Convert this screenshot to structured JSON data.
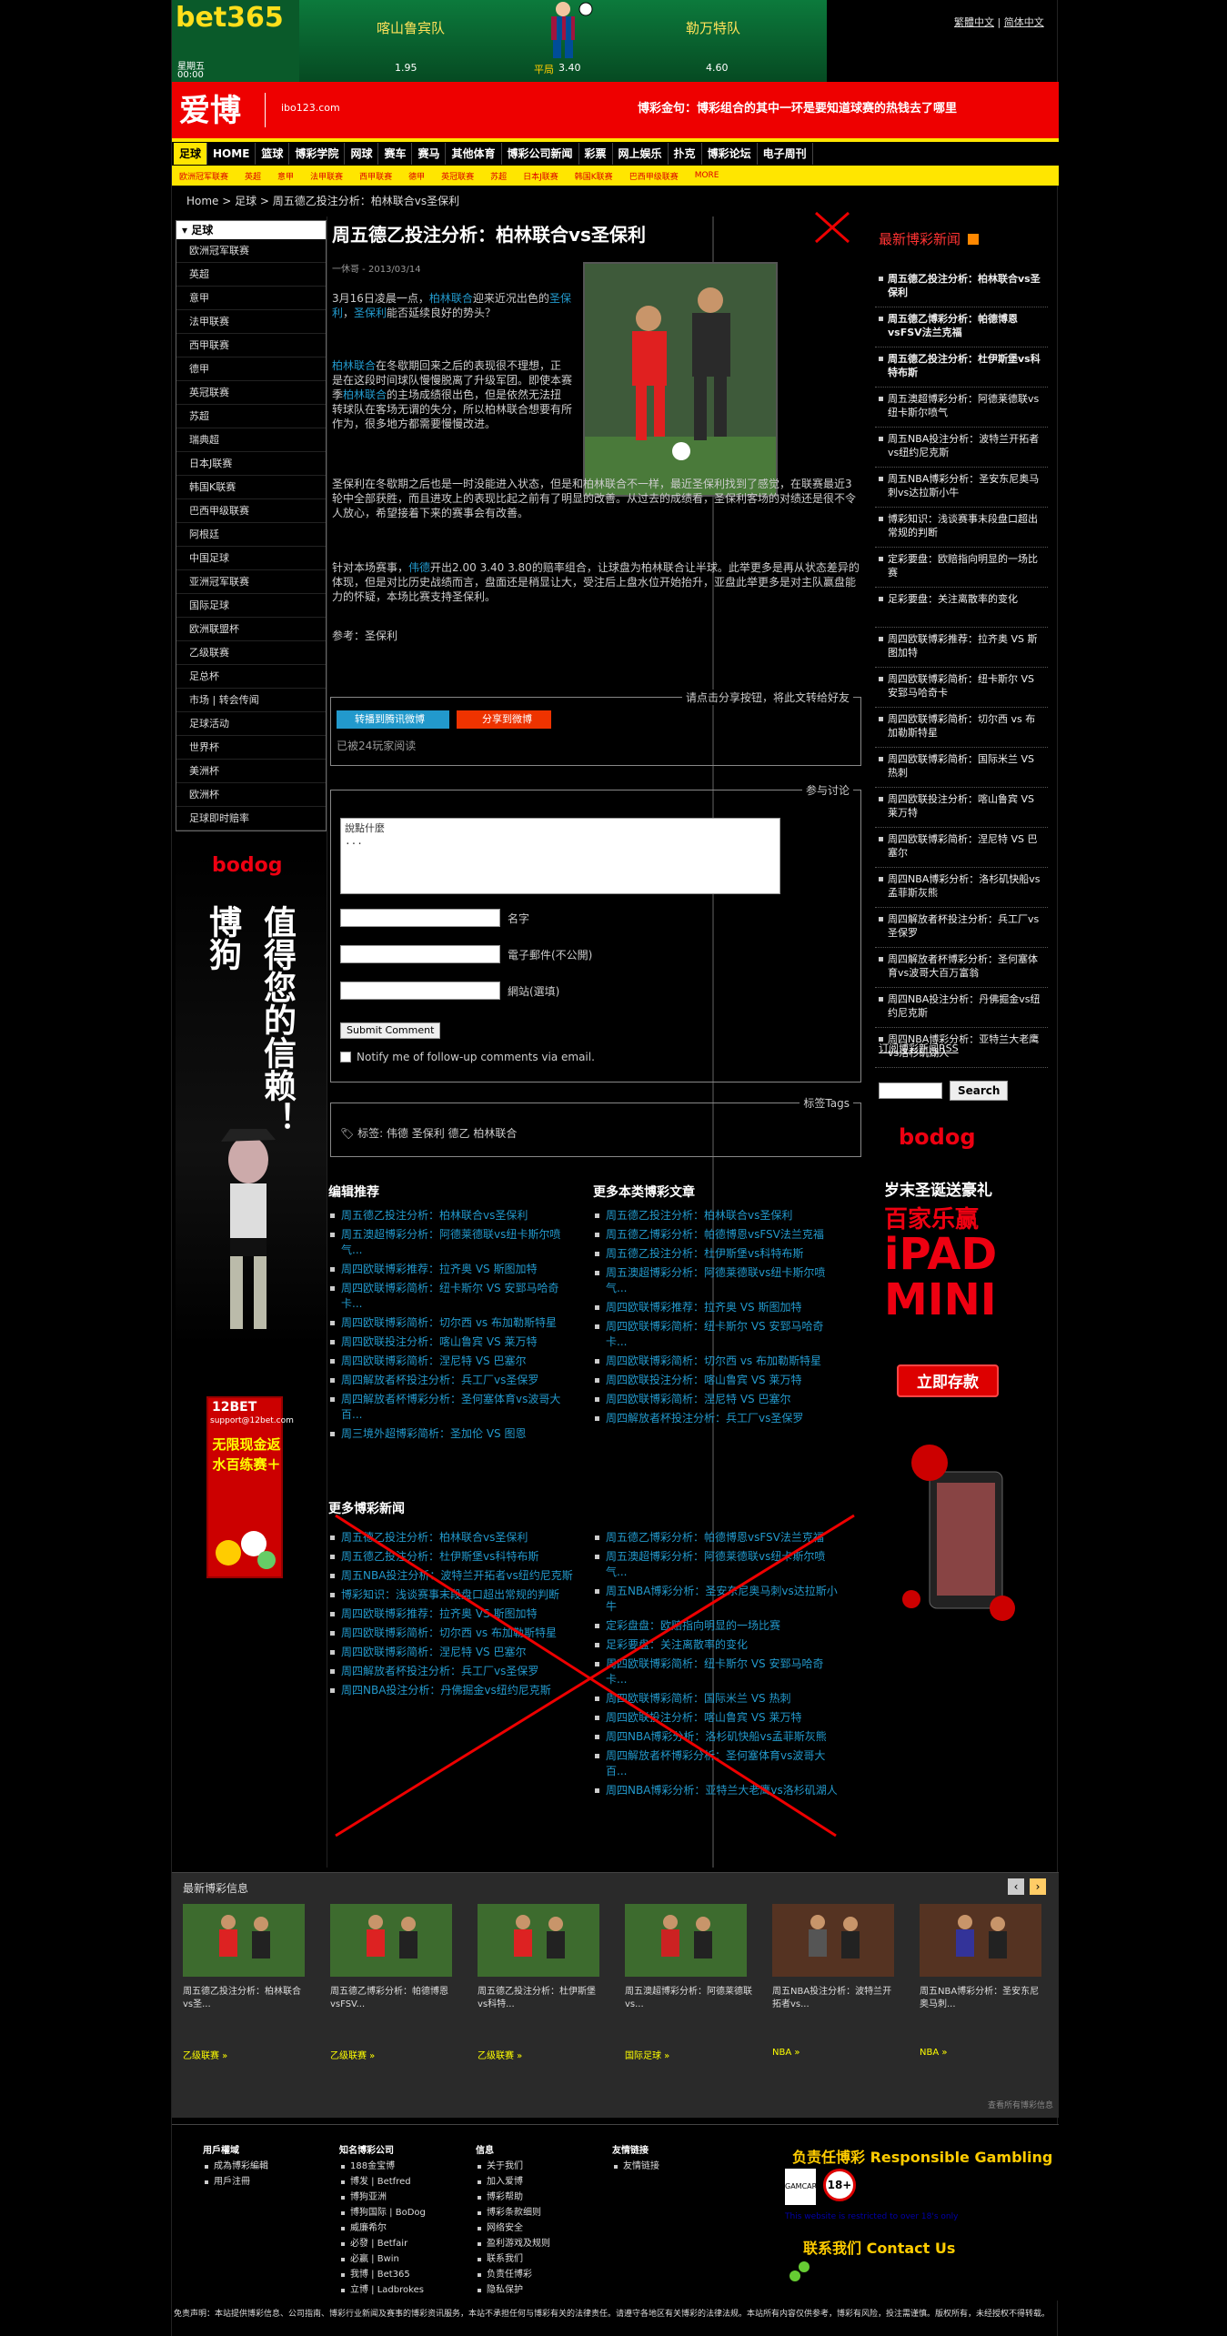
{
  "top": {
    "brand_a": "bet",
    "brand_b": "365",
    "day": "星期五",
    "time": "00:00",
    "home_team": "喀山鲁宾队",
    "away_team": "勒万特队",
    "odd_home": "1.95",
    "odd_draw": "3.40",
    "odd_away": "4.60",
    "draw_label": "平局",
    "links": [
      "繁體中文",
      "简体中文"
    ]
  },
  "aibo": {
    "logo": "爱博",
    "url": "ibo123.com",
    "slogan": "博彩金句：博彩组合的其中一环是要知道球赛的热钱去了哪里"
  },
  "nav": [
    "足球",
    "HOME",
    "篮球",
    "博彩学院",
    "网球",
    "赛车",
    "赛马",
    "其他体育",
    "博彩公司新闻",
    "彩票",
    "网上娱乐",
    "扑克",
    "博彩论坛",
    "电子周刊"
  ],
  "subnav": [
    "欧洲冠军联赛",
    "英超",
    "意甲",
    "法甲联赛",
    "西甲联赛",
    "德甲",
    "英冠联赛",
    "苏超",
    "日本J联赛",
    "韩国K联赛",
    "巴西甲级联赛",
    "MORE"
  ],
  "breadcrumb": "Home > 足球 > 周五德乙投注分析：柏林联合vs圣保利",
  "leftcat": {
    "head": "足球",
    "items": [
      "欧洲冠军联赛",
      "英超",
      "意甲",
      "法甲联赛",
      "西甲联赛",
      "德甲",
      "英冠联赛",
      "苏超",
      "瑞典超",
      "日本J联赛",
      "韩国K联赛",
      "巴西甲级联赛",
      "阿根廷",
      "中国足球",
      "亚洲冠军联赛",
      "国际足球",
      "欧洲联盟杯",
      "乙级联赛",
      "足总杯",
      "市场 | 转会传闻",
      "足球活动",
      "世界杯",
      "美洲杯",
      "欧洲杯",
      "足球即时赔率"
    ]
  },
  "bodog_left": {
    "brand": "bodog",
    "cn": "博狗",
    "slogan1": "博狗",
    "slogan2": "值得您的信赖！"
  },
  "ad12": {
    "brand": "12BET",
    "site": "support@12bet.com",
    "copy": "无限现金返水百练赛＋"
  },
  "article": {
    "title": "周五德乙投注分析：柏林联合vs圣保利",
    "meta": "一休哥 - 2013/03/14",
    "p1_pre": "3月16日凌晨一点，",
    "p1_link1": "柏林联合",
    "p1_mid": "迎来近况出色的",
    "p1_link2": "圣保利",
    "p1_mid2": "，",
    "p1_link3": "圣保利",
    "p1_post": "能否延续良好的势头？",
    "p2_link1": "柏林联合",
    "p2_a": "在冬歇期回来之后的表现很不理想，正是在这段时间球队慢慢脱离了升级军团。即使本赛季",
    "p2_link2": "柏林联合",
    "p2_b": "的主场成绩很出色，但是依然无法扭转球队在客场无谓的失分，所以柏林联合想要有所作为，很多地方都需要慢慢改进。",
    "p3": "圣保利在冬歇期之后也是一时没能进入状态，但是和柏林联合不一样，最近圣保利找到了感觉，在联赛最近3轮中全部获胜，而且进攻上的表现比起之前有了明显的改善。从过去的成绩看，圣保利客场的对绩还是很不令人放心，希望接着下来的赛事会有改善。",
    "p4_pre": "针对本场赛事，",
    "p4_link": "伟德",
    "p4_post": "开出2.00 3.40 3.80的赔率组合，让球盘为柏林联合让半球。此举更多是再从状态差异的体现，但是对比历史战绩而言，盘面还是稍显让大，受注后上盘水位开始抬升，亚盘此举更多是对主队赢盘能力的怀疑，本场比赛支持圣保利。",
    "ref": "参考：圣保利"
  },
  "share": {
    "legend": "请点击分享按钮，将此文转给好友",
    "btn1": "转播到腾讯微博",
    "btn2": "分享到微博",
    "read": "已被24玩家阅读"
  },
  "comment": {
    "legend": "参与讨论",
    "text": "說點什麼\n...",
    "name": "名字",
    "email": "電子郵件(不公開)",
    "site": "網站(選填)",
    "submit": "Submit Comment",
    "notify": "Notify me of follow-up comments via email."
  },
  "tags": {
    "legend": "标签Tags",
    "line": "标签: 伟德 圣保利 德乙 柏林联合"
  },
  "editor": {
    "head": "编辑推荐",
    "items": [
      "周五德乙投注分析：柏林联合vs圣保利",
      "周五澳超博彩分析：阿德莱德联vs纽卡斯尔喷气...",
      "周四欧联博彩推荐：拉齐奥 VS 斯图加特",
      "周四欧联博彩简析：纽卡斯尔 VS 安郅马哈奇卡...",
      "周四欧联博彩简析：切尔西 vs 布加勒斯特星",
      "周四欧联投注分析：喀山鲁宾 VS 莱万特",
      "周四欧联博彩简析：涅尼特 VS 巴塞尔",
      "周四解放者杯投注分析：兵工厂vs圣保罗",
      "周四解放者杯博彩分析：圣何塞体育vs波哥大百...",
      "周三境外超博彩简析：圣加伦 VS 图恩"
    ]
  },
  "more_cat": {
    "head": "更多本类博彩文章",
    "items": [
      "周五德乙投注分析：柏林联合vs圣保利",
      "周五德乙博彩分析：帕德博恩vsFSV法兰克福",
      "周五德乙投注分析：杜伊斯堡vs科特布斯",
      "周五澳超博彩分析：阿德莱德联vs纽卡斯尔喷气...",
      "周四欧联博彩推荐：拉齐奥 VS 斯图加特",
      "周四欧联博彩简析：纽卡斯尔 VS 安郅马哈奇卡...",
      "周四欧联博彩简析：切尔西 vs 布加勒斯特星",
      "周四欧联投注分析：喀山鲁宾 VS 莱万特",
      "周四欧联博彩简析：涅尼特 VS 巴塞尔",
      "周四解放者杯投注分析：兵工厂vs圣保罗"
    ]
  },
  "more_news": {
    "head": "更多博彩新闻",
    "left": [
      "周五德乙投注分析：柏林联合vs圣保利",
      "周五德乙投注分析：杜伊斯堡vs科特布斯",
      "周五NBA投注分析：波特兰开拓者vs纽约尼克斯",
      "博彩知识：浅谈赛事末段盘口超出常规的判断",
      "周四欧联博彩推荐：拉齐奥 VS 斯图加特",
      "周四欧联博彩简析：切尔西 vs 布加勒斯特星",
      "周四欧联博彩简析：涅尼特 VS 巴塞尔",
      "周四解放者杯投注分析：兵工厂vs圣保罗",
      "周四NBA投注分析：丹佛掘金vs纽约尼克斯"
    ],
    "right": [
      "周五德乙博彩分析：帕德博恩vsFSV法兰克福",
      "周五澳超博彩分析：阿德莱德联vs纽卡斯尔喷气...",
      "周五NBA博彩分析：圣安东尼奥马刺vs达拉斯小牛",
      "定彩盘盘：欧赔指向明显的一场比赛",
      "足彩要盘：关注离散率的变化",
      "周四欧联博彩简析：纽卡斯尔 VS 安郅马哈奇卡...",
      "周四欧联博彩简析：国际米兰 VS 热刺",
      "周四欧联投注分析：喀山鲁宾 VS 莱万特",
      "周四NBA博彩分析：洛杉矶快船vs孟菲斯灰熊",
      "周四解放者杯博彩分析：圣何塞体育vs波哥大百...",
      "周四NBA博彩分析：亚特兰大老鹰vs洛杉矶湖人"
    ]
  },
  "right": {
    "head": "最新博彩新闻",
    "items": [
      "周五德乙投注分析：柏林联合vs圣保利",
      "周五德乙博彩分析：帕德博恩vsFSV法兰克福",
      "周五德乙投注分析：杜伊斯堡vs科特布斯",
      "周五澳超博彩分析：阿德莱德联vs纽卡斯尔喷气",
      "周五NBA投注分析：波特兰开拓者vs纽约尼克斯",
      "周五NBA博彩分析：圣安东尼奥马刺vs达拉斯小牛",
      "博彩知识：浅谈赛事末段盘口超出常规的判断",
      "定彩要盘：欧赔指向明显的一场比赛",
      "足彩要盘：关注离散率的变化",
      "周四欧联博彩推荐：拉齐奥 VS 斯图加特",
      "周四欧联博彩简析：纽卡斯尔 VS 安郅马哈奇卡",
      "周四欧联博彩简析：切尔西 vs 布加勒斯特星",
      "周四欧联博彩简析：国际米兰 VS 热刺",
      "周四欧联投注分析：喀山鲁宾 VS 莱万特",
      "周四欧联博彩简析：涅尼特 VS 巴塞尔",
      "周四NBA博彩分析：洛杉矶快船vs孟菲斯灰熊",
      "周四解放者杯投注分析：兵工厂vs圣保罗",
      "周四解放者杯博彩分析：圣何塞体育vs波哥大百万富翁",
      "周四NBA投注分析：丹佛掘金vs纽约尼克斯",
      "周四NBA博彩分析：亚特兰大老鹰vs洛杉矶湖人"
    ],
    "rss": "订阅博彩新闻RSS",
    "search_btn": "Search"
  },
  "bodog_right": {
    "brand": "bodog",
    "l1": "岁末圣诞送豪礼",
    "l2": "百家乐赢",
    "l3": "iPAD",
    "l4": "MINI",
    "btn": "立即存款"
  },
  "carousel": {
    "title": "最新博彩信息",
    "cards": [
      {
        "cap": "周五德乙投注分析：柏林联合vs圣...",
        "cat": "乙级联赛 »"
      },
      {
        "cap": "周五德乙博彩分析：帕德博恩vsFSV...",
        "cat": "乙级联赛 »"
      },
      {
        "cap": "周五德乙投注分析：杜伊斯堡vs科特...",
        "cat": "乙级联赛 »"
      },
      {
        "cap": "周五澳超博彩分析：阿德莱德联vs...",
        "cat": "国际足球 »"
      },
      {
        "cap": "周五NBA投注分析：波特兰开拓者vs...",
        "cat": "NBA »"
      },
      {
        "cap": "周五NBA博彩分析：圣安东尼奥马刺...",
        "cat": "NBA »"
      }
    ],
    "foot": "查看所有博彩信息"
  },
  "footer": {
    "c1": {
      "h": "用戶權域",
      "items": [
        "成為博彩編輯",
        "用戶注冊"
      ]
    },
    "c2": {
      "h": "知名博彩公司",
      "items": [
        "188金宝博",
        "博发 | Betfred",
        "博狗亚洲",
        "博狗国际 | BoDog",
        "威廉希尔",
        "必發 | Betfair",
        "必赢 | Bwin",
        "我博 | Bet365",
        "立博 | Ladbrokes"
      ]
    },
    "c3": {
      "h": "信息",
      "items": [
        "关于我们",
        "加入爱博",
        "博彩帮助",
        "博彩条款细则",
        "网络安全",
        "盈利游戏及规则",
        "联系我们",
        "负责任博彩",
        "隐私保护"
      ]
    },
    "c4": {
      "h": "友情链接",
      "items": [
        "友情链接"
      ]
    },
    "rg": "负责任博彩 Responsible Gambling",
    "gc": "GAMCARE",
    "a18": "18+",
    "rgnote": "This website is restricted to over 18's only",
    "contact": "联系我们 Contact Us"
  },
  "copyright": "免责声明：本站提供博彩信息、公司指南、博彩行业新闻及赛事的博彩资讯服务，本站不承担任何与博彩有关的法律责任。请遵守各地区有关博彩的法律法规。本站所有内容仅供参考，博彩有风险，投注需谨慎。版权所有，未经授权不得转载。"
}
